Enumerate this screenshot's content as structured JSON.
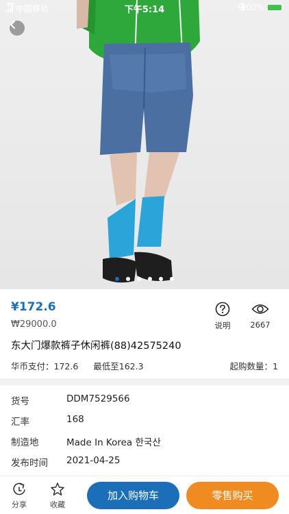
{
  "status_bar": {
    "carrier": "中国移动",
    "time": "下午5:14",
    "battery": "100%"
  },
  "gallery": {
    "image_count": 6,
    "active_index": 0
  },
  "product": {
    "price": "¥172.6",
    "original_price": "₩29000.0",
    "title": "东大门爆款裤子休闲裤(88)42575240",
    "payment_label": "华币支付：172.6",
    "lowest_label": "最低至162.3",
    "min_qty_label": "起购数量：1"
  },
  "actions": {
    "help_label": "说明",
    "views_count": "2667"
  },
  "specs": [
    {
      "key": "货号",
      "value": "DDM7529566"
    },
    {
      "key": "汇率",
      "value": "168"
    },
    {
      "key": "制造地",
      "value": "Made In Korea 한국산"
    },
    {
      "key": "发布时间",
      "value": "2021-04-25"
    }
  ],
  "bottom_bar": {
    "share_label": "分享",
    "favorite_label": "收藏",
    "add_cart_label": "加入购物车",
    "buy_label": "零售购买"
  },
  "colors": {
    "accent_blue": "#1b6fb8",
    "accent_orange": "#f08b21"
  }
}
